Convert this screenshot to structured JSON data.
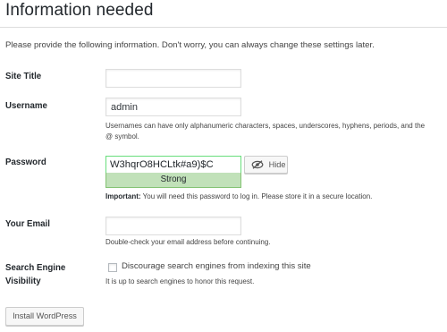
{
  "page": {
    "heading": "Information needed",
    "intro": "Please provide the following information. Don't worry, you can always change these settings later."
  },
  "fields": {
    "site_title": {
      "label": "Site Title",
      "value": ""
    },
    "username": {
      "label": "Username",
      "value": "admin",
      "description_line1": "Usernames can have only alphanumeric characters, spaces, underscores, hyphens, periods, and the",
      "description_line2": "@ symbol."
    },
    "password": {
      "label": "Password",
      "value": "W3hqrO8HCLtk#a9)$C",
      "strength": "Strong",
      "hide_label": "Hide",
      "important_label": "Important:",
      "important_text": " You will need this password to log in. Please store it in a secure location."
    },
    "email": {
      "label": "Your Email",
      "value": "",
      "description": "Double-check your email address before continuing."
    },
    "search_visibility": {
      "label_line1": "Search Engine",
      "label_line2": "Visibility",
      "checkbox_label": "Discourage search engines from indexing this site",
      "checked": false,
      "description": "It is up to search engines to honor this request."
    }
  },
  "actions": {
    "install_label": "Install WordPress"
  },
  "colors": {
    "strength_bg": "#c1e1b9",
    "strength_border": "#83c373",
    "password_border": "#68de7c"
  },
  "icons": {
    "hide": "eye-slash-icon"
  }
}
